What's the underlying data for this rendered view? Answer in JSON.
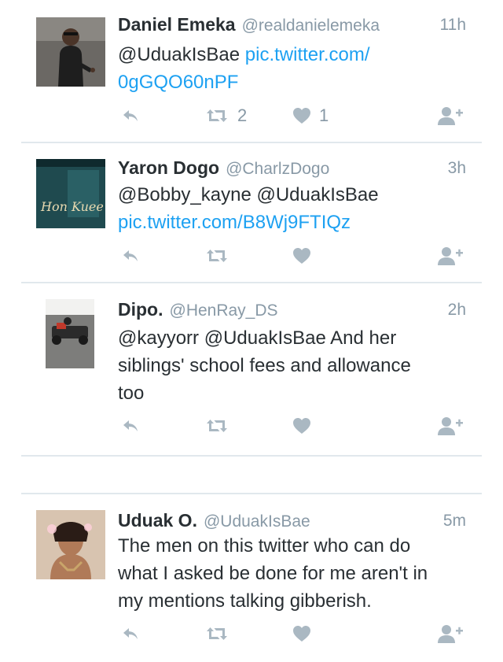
{
  "tweets": [
    {
      "name": "Daniel Emeka",
      "handle": "@realdanielemeka",
      "time": "11h",
      "text_before": "@UduakIsBae ",
      "link1": "pic.twitter.com/",
      "link2": "0gGQO60nPF",
      "retweets": "2",
      "likes": "1"
    },
    {
      "name": "Yaron Dogo",
      "handle": "@CharlzDogo",
      "time": "3h",
      "line1": "@Bobby_kayne @UduakIsBae",
      "link": "pic.twitter.com/B8Wj9FTIQz",
      "avatar_text": "Hon Kuee"
    },
    {
      "name": "Dipo.",
      "handle": "@HenRay_DS",
      "time": "2h",
      "lines": [
        "@kayyorr @UduakIsBae And her",
        "siblings' school fees and allowance",
        "too"
      ]
    },
    {
      "name": "Uduak O.",
      "handle": "@UduakIsBae",
      "time": "5m",
      "lines": [
        "The men on this twitter who can do",
        "what I asked be done for me aren't in",
        "my mentions talking gibberish."
      ]
    }
  ],
  "icons": {
    "reply": "reply-icon",
    "retweet": "retweet-icon",
    "like": "heart-icon",
    "follow": "follow-icon"
  },
  "colors": {
    "text": "#292f33",
    "muted": "#8899a6",
    "link": "#1da1f2",
    "icon": "#aab8c2",
    "divider": "#e1e8ed"
  }
}
